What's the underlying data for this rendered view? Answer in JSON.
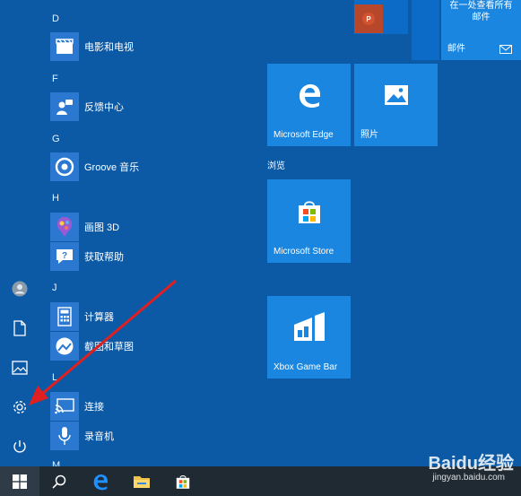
{
  "colors": {
    "background": "#0c5aa6",
    "tile": "#1b86df",
    "taskbar": "#1f2a33",
    "arrow": "#e02020"
  },
  "app_list": {
    "letters": [
      "D",
      "F",
      "G",
      "H",
      "J",
      "L",
      "M"
    ],
    "apps": [
      {
        "name": "电影和电视",
        "icon": "film-icon"
      },
      {
        "name": "反馈中心",
        "icon": "feedback-icon"
      },
      {
        "name": "Groove 音乐",
        "icon": "groove-icon"
      },
      {
        "name": "画图 3D",
        "icon": "paint3d-icon"
      },
      {
        "name": "获取帮助",
        "icon": "help-icon"
      },
      {
        "name": "计算器",
        "icon": "calculator-icon"
      },
      {
        "name": "截图和草图",
        "icon": "snip-icon"
      },
      {
        "name": "连接",
        "icon": "connect-icon"
      },
      {
        "name": "录音机",
        "icon": "recorder-icon"
      }
    ]
  },
  "tiles": {
    "mail_top_text_1": "在一处查看所有",
    "mail_top_text_2": "邮件",
    "mail_label": "邮件",
    "edge_label": "Microsoft Edge",
    "photos_label": "照片",
    "group_label": "浏览",
    "store_label": "Microsoft Store",
    "xbox_label": "Xbox Game Bar"
  },
  "rail": [
    "user-icon",
    "documents-icon",
    "pictures-icon",
    "settings-icon",
    "power-icon"
  ],
  "taskbar": [
    "windows-start-icon",
    "search-icon",
    "edge-icon",
    "file-explorer-icon",
    "store-icon"
  ],
  "watermark": {
    "brand": "Baidu经验",
    "url": "jingyan.baidu.com"
  }
}
